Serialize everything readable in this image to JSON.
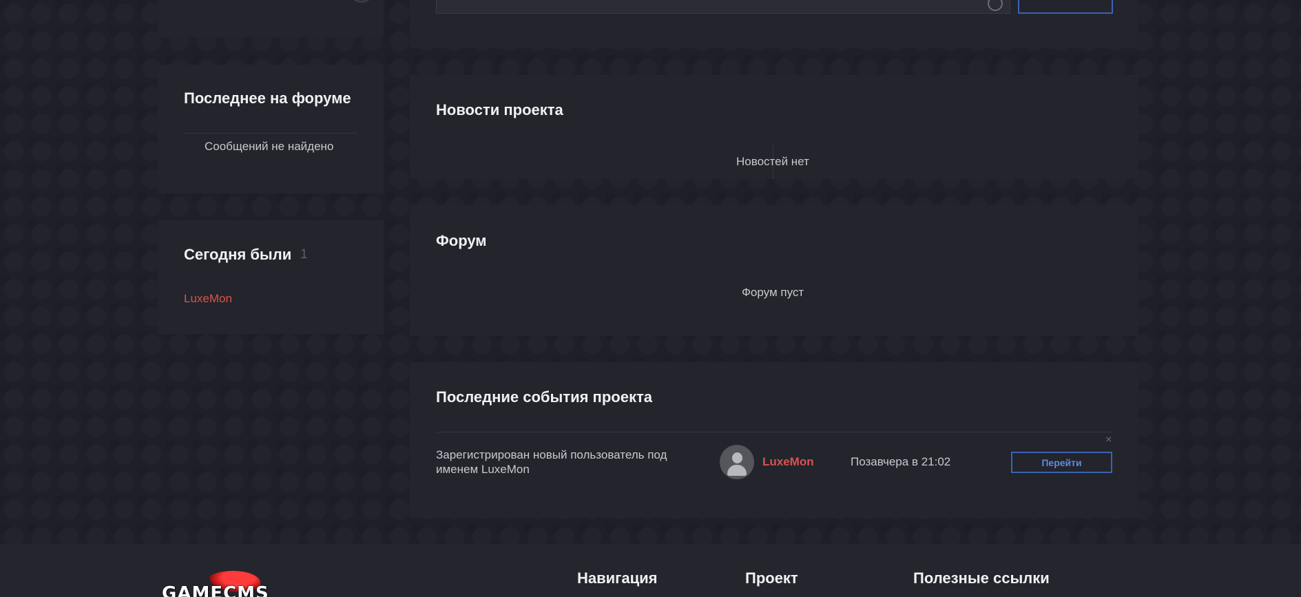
{
  "forum_latest": {
    "title": "Последнее на форуме",
    "empty_text": "Сообщений не найдено"
  },
  "today_visitors": {
    "title": "Сегодня были",
    "count": "1",
    "users": [
      "LuxeMon"
    ]
  },
  "news": {
    "title": "Новости проекта",
    "empty_text": "Новостей нет"
  },
  "forum": {
    "title": "Форум",
    "empty_text": "Форум пуст"
  },
  "events": {
    "title": "Последние события проекта",
    "items": [
      {
        "text": "Зарегистрирован новый пользователь под именем LuxeMon",
        "user": "LuxeMon",
        "time": "Позавчера в 21:02",
        "action_label": "Перейти",
        "close_label": "×"
      }
    ]
  },
  "footer": {
    "logo_text": "GAMECMS",
    "columns": [
      "Навигация",
      "Проект",
      "Полезные ссылки"
    ]
  },
  "colors": {
    "background": "#1e1f29",
    "panel": "#23242c",
    "accent_blue": "#3b63b8",
    "username_red": "#d9534f"
  }
}
